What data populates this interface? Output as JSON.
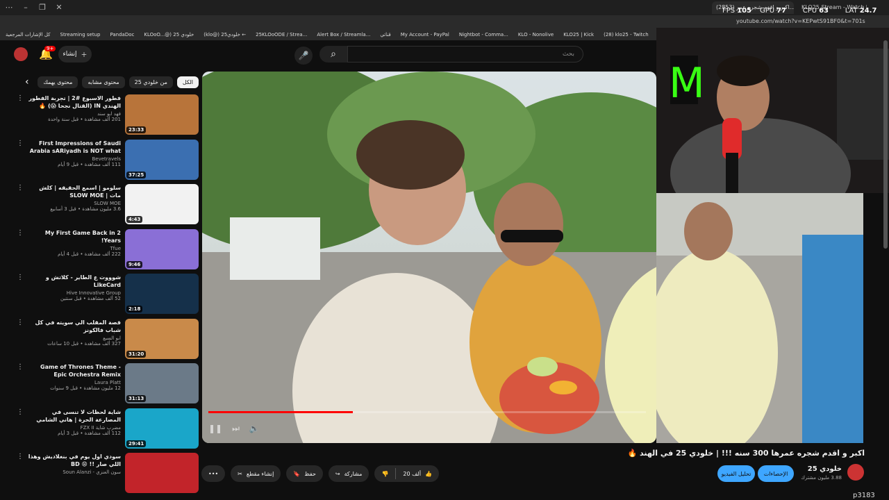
{
  "browser": {
    "stats": {
      "fps_label": "FPS",
      "fps": "105",
      "gpu_label": "GPU",
      "gpu": "77 %",
      "cpu_label": "CPU",
      "cpu": "63 %",
      "lat_label": "LAT",
      "lat": "24.7 ms"
    },
    "tabs": [
      {
        "label": "(2853) اكبر و اقدم شجره عمر..."
      },
      {
        "label": "KLO25 Stream - Watch Live on"
      }
    ],
    "url": "youtube.com/watch?v=KEPwtS91BF0&t=701s",
    "bookmarks": [
      "كل الإشارات المرجعية",
      "Streaming setup",
      "PandaDoc",
      "KLOoO...@) خلودي 25",
      "(klo@) خلودي25 ←",
      "25KLOoODE / Strea...",
      "Alert Box / Streamla...",
      "قناتي",
      "My Account - PayPal",
      "Nightbot - Comma...",
      "KLO - Nonolive",
      "KLO25 | Kick",
      "(28) klo25 - Twitch"
    ]
  },
  "header": {
    "search_placeholder": "بحث",
    "create_label": "إنشاء",
    "notif_count": "9+"
  },
  "chips": [
    {
      "label": "الكل",
      "active": true
    },
    {
      "label": "من خلودي 25"
    },
    {
      "label": "محتوى مشابه"
    },
    {
      "label": "محتوى يهمك"
    }
  ],
  "sidebar": {
    "videos": [
      {
        "title": "فطور الاسبوع #2 | تجربة الفطور الهندي IN (القتال نجحا 😱) 🔥",
        "channel": "فهد ابو سند",
        "stats": "201 ألف مشاهدة • قبل سنة واحدة",
        "duration": "23:33",
        "color": "#b8743a"
      },
      {
        "title": "First Impressions of Saudi Arabia sARiyadh is NOT what we...",
        "channel": "Bevetravels",
        "stats": "111 ألف مشاهدة • قبل 9 أيام",
        "duration": "37:25",
        "color": "#3b6fb1"
      },
      {
        "title": "سلومو | اسمع الحقيقه | كلش مات | SLOW MOE",
        "channel": "SLOW MOE",
        "stats": "3.6 مليون مشاهدة • قبل 3 أسابيع",
        "duration": "4:43",
        "color": "#f2f2f2"
      },
      {
        "title": "My First Game Back in 2 Years!",
        "channel": "Tfue",
        "stats": "222 ألف مشاهدة • قبل 4 أيام",
        "duration": "9:46",
        "color": "#8a6fd6"
      },
      {
        "title": "شوووت ع الطاير - كلاتش و LikeCard",
        "channel": "Hive Innovative Group",
        "stats": "52 ألف مشاهدة • قبل سنتين",
        "duration": "2:18",
        "color": "#15304a"
      },
      {
        "title": "قصة المقلب الي سويته في كل شباب فالكونز",
        "channel": "ابو السبع",
        "stats": "327 ألف مشاهدة • قبل 10 ساعات",
        "duration": "31:20",
        "color": "#c98a4a"
      },
      {
        "title": "Game of Thrones Theme - Epic Orchestra Remix (Extended)",
        "channel": "Laura Platt",
        "stats": "12 مليون مشاهدة • قبل 9 سنوات",
        "duration": "31:13",
        "color": "#6b7a88"
      },
      {
        "title": "شاية لحظات لا تنسى في المصارعة الحرة | هاني الشامي",
        "channel": "مضرب شاية FZX II",
        "stats": "112 ألف مشاهدة • قبل 3 أيام",
        "duration": "29:41",
        "color": "#1aa6c9"
      },
      {
        "title": "سودي اول يوم في بنغلاديش وهذا اللي صار !! 😩 BD",
        "channel": "سون العنزي - Soun Alanzi",
        "stats": "",
        "duration": "",
        "color": "#c2242a"
      }
    ]
  },
  "video": {
    "title": "اكبر و اقدم شجره عمرها 300 سنه !!! | خلودي 25 في الهند 🔥",
    "progress": 0.33,
    "channel": {
      "name": "خلودي 25",
      "subs": "3.88 مليون مشترك"
    },
    "subscribe_label": "تحليل الفيديو",
    "analytics_label": "الإحصاءات",
    "actions": {
      "like": "20 ألف",
      "share": "مشاركة",
      "save": "حفظ",
      "clip": "إنشاء مقطع"
    }
  },
  "overlay": {
    "tag": "p3183"
  },
  "colors": {
    "bg": "#0f0f0f",
    "accent": "#3ea6ff",
    "progress": "#ff0000",
    "brand_red": "#e00000"
  }
}
